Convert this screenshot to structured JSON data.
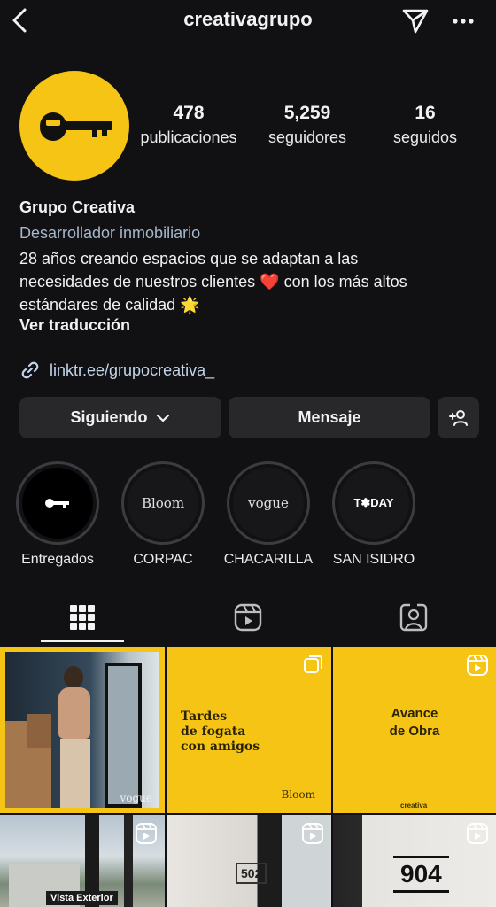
{
  "header": {
    "username": "creativagrupo",
    "back_icon": "back-arrow-icon",
    "send_icon": "paper-plane-icon",
    "more_icon": "more-options-icon"
  },
  "profile": {
    "avatar_color": "#f5c414",
    "stats": [
      {
        "value": "478",
        "label": "publicaciones"
      },
      {
        "value": "5,259",
        "label": "seguidores"
      },
      {
        "value": "16",
        "label": "seguidos"
      }
    ],
    "name": "Grupo Creativa",
    "category": "Desarrollador inmobiliario",
    "bio_lines": [
      "28 años creando espacios que se adaptan a las",
      "necesidades de nuestros clientes ❤️ con los más altos",
      "estándares de calidad 🌟"
    ],
    "translate_label": "Ver traducción",
    "link": "linktr.ee/grupocreativa_"
  },
  "actions": {
    "following_label": "Siguiendo",
    "message_label": "Mensaje",
    "add_user_icon": "add-user-icon"
  },
  "highlights": [
    {
      "title": "Entregados",
      "cover": "key"
    },
    {
      "title": "CORPAC",
      "cover_text": "Bloom"
    },
    {
      "title": "CHACARILLA",
      "cover_text": "vogue"
    },
    {
      "title": "SAN ISIDRO",
      "cover_text": "T✽DAY"
    }
  ],
  "tabs": [
    {
      "icon": "grid-icon",
      "active": true
    },
    {
      "icon": "reels-icon",
      "active": false
    },
    {
      "icon": "tagged-icon",
      "active": false
    }
  ],
  "grid": {
    "post1": {
      "brand": "vogue"
    },
    "post2": {
      "title_lines": [
        "Tardes",
        "de fogata",
        "con amigos"
      ],
      "brand": "Bloom"
    },
    "post3": {
      "title_lines": [
        "Avance",
        "de Obra"
      ],
      "brand": "creativa"
    },
    "post4": {
      "caption": "Vista Exterior"
    },
    "post5": {
      "unit": "502"
    },
    "post6": {
      "unit": "904"
    }
  },
  "colors": {
    "background": "#111113",
    "accent": "#f5c414",
    "button": "#28282b",
    "link": "#c3d4ea",
    "category": "#a6b7c9"
  }
}
